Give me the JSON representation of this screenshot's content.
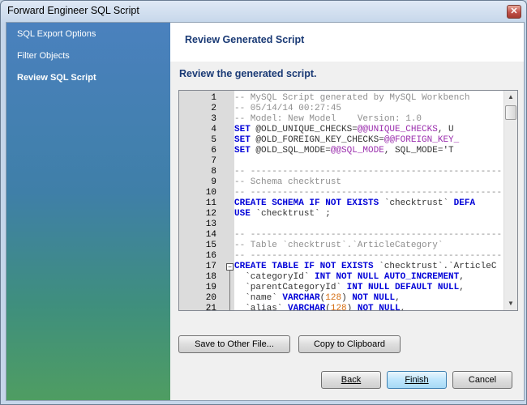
{
  "window": {
    "title": "Forward Engineer SQL Script",
    "close_glyph": "✕"
  },
  "sidebar": {
    "items": [
      {
        "label": "SQL Export Options",
        "active": false
      },
      {
        "label": "Filter Objects",
        "active": false
      },
      {
        "label": "Review SQL Script",
        "active": true
      }
    ]
  },
  "header": {
    "title": "Review Generated Script"
  },
  "subtitle": "Review the generated script.",
  "editor": {
    "lines": [
      {
        "n": "1",
        "t": [
          [
            "c",
            "-- MySQL Script generated by MySQL Workbench"
          ]
        ]
      },
      {
        "n": "2",
        "t": [
          [
            "c",
            "-- 05/14/14 00:27:45"
          ]
        ]
      },
      {
        "n": "3",
        "t": [
          [
            "c",
            "-- Model: New Model    Version: 1.0"
          ]
        ]
      },
      {
        "n": "4",
        "t": [
          [
            "k",
            "SET "
          ],
          [
            "s",
            "@OLD_UNIQUE_CHECKS="
          ],
          [
            "v",
            "@@UNIQUE_CHECKS"
          ],
          [
            "s",
            ", U"
          ]
        ]
      },
      {
        "n": "5",
        "t": [
          [
            "k",
            "SET "
          ],
          [
            "s",
            "@OLD_FOREIGN_KEY_CHECKS="
          ],
          [
            "v",
            "@@FOREIGN_KEY_"
          ]
        ]
      },
      {
        "n": "6",
        "t": [
          [
            "k",
            "SET "
          ],
          [
            "s",
            "@OLD_SQL_MODE="
          ],
          [
            "v",
            "@@SQL_MODE"
          ],
          [
            "s",
            ", SQL_MODE='T"
          ]
        ]
      },
      {
        "n": "7",
        "t": [
          [
            "s",
            ""
          ]
        ]
      },
      {
        "n": "8",
        "t": [
          [
            "c",
            "-- -----------------------------------------------"
          ]
        ]
      },
      {
        "n": "9",
        "t": [
          [
            "c",
            "-- Schema checktrust"
          ]
        ]
      },
      {
        "n": "10",
        "t": [
          [
            "c",
            "-- -----------------------------------------------"
          ]
        ]
      },
      {
        "n": "11",
        "t": [
          [
            "k",
            "CREATE SCHEMA IF NOT EXISTS "
          ],
          [
            "s",
            "`checktrust` "
          ],
          [
            "k",
            "DEFA"
          ]
        ]
      },
      {
        "n": "12",
        "t": [
          [
            "k",
            "USE "
          ],
          [
            "s",
            "`checktrust` ;"
          ]
        ]
      },
      {
        "n": "13",
        "t": [
          [
            "s",
            ""
          ]
        ]
      },
      {
        "n": "14",
        "t": [
          [
            "c",
            "-- -----------------------------------------------"
          ]
        ]
      },
      {
        "n": "15",
        "t": [
          [
            "c",
            "-- Table `checktrust`.`ArticleCategory`"
          ]
        ]
      },
      {
        "n": "16",
        "t": [
          [
            "c",
            "-- -----------------------------------------------"
          ]
        ]
      },
      {
        "n": "17",
        "t": [
          [
            "k",
            "CREATE TABLE IF NOT EXISTS "
          ],
          [
            "s",
            "`checktrust`.`ArticleC"
          ]
        ]
      },
      {
        "n": "18",
        "t": [
          [
            "s",
            "  `categoryId` "
          ],
          [
            "k",
            "INT NOT NULL AUTO_INCREMENT"
          ],
          [
            "s",
            ","
          ]
        ]
      },
      {
        "n": "19",
        "t": [
          [
            "s",
            "  `parentCategoryId` "
          ],
          [
            "k",
            "INT NULL DEFAULT NULL"
          ],
          [
            "s",
            ","
          ]
        ]
      },
      {
        "n": "20",
        "t": [
          [
            "s",
            "  `name` "
          ],
          [
            "k",
            "VARCHAR"
          ],
          [
            "s",
            "("
          ],
          [
            "n",
            "128"
          ],
          [
            "s",
            ") "
          ],
          [
            "k",
            "NOT NULL"
          ],
          [
            "s",
            ","
          ]
        ]
      },
      {
        "n": "21",
        "t": [
          [
            "s",
            "  `alias` "
          ],
          [
            "k",
            "VARCHAR"
          ],
          [
            "s",
            "("
          ],
          [
            "n",
            "128"
          ],
          [
            "s",
            ") "
          ],
          [
            "k",
            "NOT NULL"
          ],
          [
            "s",
            ","
          ]
        ]
      }
    ],
    "scroll_up": "▲",
    "scroll_down": "▼",
    "fold_glyph": "−"
  },
  "buttons": {
    "save_file": "Save to Other File...",
    "copy_clipboard": "Copy to Clipboard",
    "back": "Back",
    "finish": "Finish",
    "cancel": "Cancel"
  }
}
